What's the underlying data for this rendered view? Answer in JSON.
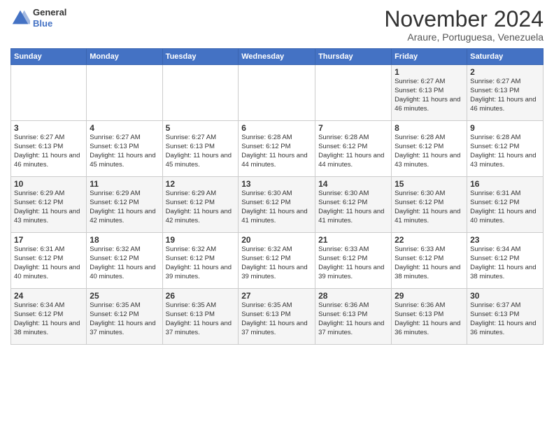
{
  "logo": {
    "line1": "General",
    "line2": "Blue"
  },
  "title": "November 2024",
  "subtitle": "Araure, Portuguesa, Venezuela",
  "days_header": [
    "Sunday",
    "Monday",
    "Tuesday",
    "Wednesday",
    "Thursday",
    "Friday",
    "Saturday"
  ],
  "weeks": [
    [
      {
        "day": "",
        "info": ""
      },
      {
        "day": "",
        "info": ""
      },
      {
        "day": "",
        "info": ""
      },
      {
        "day": "",
        "info": ""
      },
      {
        "day": "",
        "info": ""
      },
      {
        "day": "1",
        "info": "Sunrise: 6:27 AM\nSunset: 6:13 PM\nDaylight: 11 hours and 46 minutes."
      },
      {
        "day": "2",
        "info": "Sunrise: 6:27 AM\nSunset: 6:13 PM\nDaylight: 11 hours and 46 minutes."
      }
    ],
    [
      {
        "day": "3",
        "info": "Sunrise: 6:27 AM\nSunset: 6:13 PM\nDaylight: 11 hours and 46 minutes."
      },
      {
        "day": "4",
        "info": "Sunrise: 6:27 AM\nSunset: 6:13 PM\nDaylight: 11 hours and 45 minutes."
      },
      {
        "day": "5",
        "info": "Sunrise: 6:27 AM\nSunset: 6:13 PM\nDaylight: 11 hours and 45 minutes."
      },
      {
        "day": "6",
        "info": "Sunrise: 6:28 AM\nSunset: 6:12 PM\nDaylight: 11 hours and 44 minutes."
      },
      {
        "day": "7",
        "info": "Sunrise: 6:28 AM\nSunset: 6:12 PM\nDaylight: 11 hours and 44 minutes."
      },
      {
        "day": "8",
        "info": "Sunrise: 6:28 AM\nSunset: 6:12 PM\nDaylight: 11 hours and 43 minutes."
      },
      {
        "day": "9",
        "info": "Sunrise: 6:28 AM\nSunset: 6:12 PM\nDaylight: 11 hours and 43 minutes."
      }
    ],
    [
      {
        "day": "10",
        "info": "Sunrise: 6:29 AM\nSunset: 6:12 PM\nDaylight: 11 hours and 43 minutes."
      },
      {
        "day": "11",
        "info": "Sunrise: 6:29 AM\nSunset: 6:12 PM\nDaylight: 11 hours and 42 minutes."
      },
      {
        "day": "12",
        "info": "Sunrise: 6:29 AM\nSunset: 6:12 PM\nDaylight: 11 hours and 42 minutes."
      },
      {
        "day": "13",
        "info": "Sunrise: 6:30 AM\nSunset: 6:12 PM\nDaylight: 11 hours and 41 minutes."
      },
      {
        "day": "14",
        "info": "Sunrise: 6:30 AM\nSunset: 6:12 PM\nDaylight: 11 hours and 41 minutes."
      },
      {
        "day": "15",
        "info": "Sunrise: 6:30 AM\nSunset: 6:12 PM\nDaylight: 11 hours and 41 minutes."
      },
      {
        "day": "16",
        "info": "Sunrise: 6:31 AM\nSunset: 6:12 PM\nDaylight: 11 hours and 40 minutes."
      }
    ],
    [
      {
        "day": "17",
        "info": "Sunrise: 6:31 AM\nSunset: 6:12 PM\nDaylight: 11 hours and 40 minutes."
      },
      {
        "day": "18",
        "info": "Sunrise: 6:32 AM\nSunset: 6:12 PM\nDaylight: 11 hours and 40 minutes."
      },
      {
        "day": "19",
        "info": "Sunrise: 6:32 AM\nSunset: 6:12 PM\nDaylight: 11 hours and 39 minutes."
      },
      {
        "day": "20",
        "info": "Sunrise: 6:32 AM\nSunset: 6:12 PM\nDaylight: 11 hours and 39 minutes."
      },
      {
        "day": "21",
        "info": "Sunrise: 6:33 AM\nSunset: 6:12 PM\nDaylight: 11 hours and 39 minutes."
      },
      {
        "day": "22",
        "info": "Sunrise: 6:33 AM\nSunset: 6:12 PM\nDaylight: 11 hours and 38 minutes."
      },
      {
        "day": "23",
        "info": "Sunrise: 6:34 AM\nSunset: 6:12 PM\nDaylight: 11 hours and 38 minutes."
      }
    ],
    [
      {
        "day": "24",
        "info": "Sunrise: 6:34 AM\nSunset: 6:12 PM\nDaylight: 11 hours and 38 minutes."
      },
      {
        "day": "25",
        "info": "Sunrise: 6:35 AM\nSunset: 6:12 PM\nDaylight: 11 hours and 37 minutes."
      },
      {
        "day": "26",
        "info": "Sunrise: 6:35 AM\nSunset: 6:13 PM\nDaylight: 11 hours and 37 minutes."
      },
      {
        "day": "27",
        "info": "Sunrise: 6:35 AM\nSunset: 6:13 PM\nDaylight: 11 hours and 37 minutes."
      },
      {
        "day": "28",
        "info": "Sunrise: 6:36 AM\nSunset: 6:13 PM\nDaylight: 11 hours and 37 minutes."
      },
      {
        "day": "29",
        "info": "Sunrise: 6:36 AM\nSunset: 6:13 PM\nDaylight: 11 hours and 36 minutes."
      },
      {
        "day": "30",
        "info": "Sunrise: 6:37 AM\nSunset: 6:13 PM\nDaylight: 11 hours and 36 minutes."
      }
    ]
  ]
}
